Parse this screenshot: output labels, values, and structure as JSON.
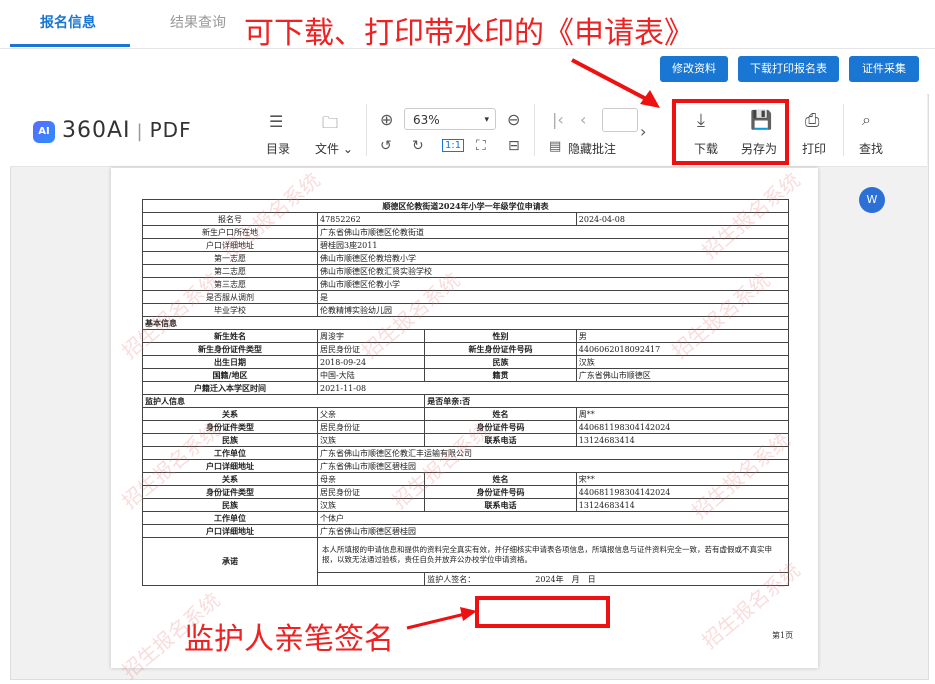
{
  "tabs": [
    {
      "label": "报名信息"
    },
    {
      "label": "结果查询"
    }
  ],
  "annotations": {
    "top": "可下载、打印带水印的《申请表》",
    "bottom": "监护人亲笔签名"
  },
  "buttons": {
    "edit": "修改资料",
    "download_print": "下载打印报名表",
    "id_collect": "证件采集"
  },
  "viewer": {
    "brand": "360AI",
    "brand_pdf": "PDF",
    "ai_badge": "AI",
    "toolbar": {
      "toc": "目录",
      "file": "文件",
      "zoom": "63%",
      "hide_notes": "隐藏批注",
      "download": "下载",
      "save_as": "另存为",
      "print": "打印",
      "find": "查找",
      "fit": "1:1"
    },
    "word_badge": "W"
  },
  "form": {
    "title": "顺德区伦教街道2024年小学一年级学位申请表",
    "top_rows": [
      {
        "label": "报名号",
        "value": "47852262",
        "extra": "2024-04-08"
      },
      {
        "label": "新生户口所在地",
        "value": "广东省佛山市顺德区伦教街道",
        "extra": ""
      },
      {
        "label": "户口详细地址",
        "value": "碧桂园3座2011",
        "extra": ""
      },
      {
        "label": "第一志愿",
        "value": "佛山市顺德区伦教培教小学",
        "extra": ""
      },
      {
        "label": "第二志愿",
        "value": "佛山市顺德区伦教汇贤实验学校",
        "extra": ""
      },
      {
        "label": "第三志愿",
        "value": "佛山市顺德区伦教小学",
        "extra": ""
      },
      {
        "label": "是否服从调剂",
        "value": "是",
        "extra": ""
      },
      {
        "label": "毕业学校",
        "value": "伦教精博实验幼儿园",
        "extra": ""
      }
    ],
    "basic_section": "基本信息",
    "basic_rows": [
      {
        "l1": "新生姓名",
        "v1": "周浚宇",
        "l2": "性别",
        "v2": "男"
      },
      {
        "l1": "新生身份证件类型",
        "v1": "居民身份证",
        "l2": "新生身份证件号码",
        "v2": "4406062018092417"
      },
      {
        "l1": "出生日期",
        "v1": "2018-09-24",
        "l2": "民族",
        "v2": "汉族"
      },
      {
        "l1": "国籍/地区",
        "v1": "中国-大陆",
        "l2": "籍贯",
        "v2": "广东省佛山市顺德区"
      }
    ],
    "move_in": {
      "label": "户籍迁入本学区时间",
      "value": "2021-11-08"
    },
    "guardian_section": "监护人信息",
    "single_parent": "是否单亲:否",
    "guardian1": {
      "rows": [
        {
          "l1": "关系",
          "v1": "父亲",
          "l2": "姓名",
          "v2": "周**"
        },
        {
          "l1": "身份证件类型",
          "v1": "居民身份证",
          "l2": "身份证件号码",
          "v2": "440681198304142024"
        },
        {
          "l1": "民族",
          "v1": "汉族",
          "l2": "联系电话",
          "v2": "13124683414"
        }
      ],
      "work": {
        "label": "工作单位",
        "value": "广东省佛山市顺德区伦教汇丰运输有限公司"
      },
      "addr": {
        "label": "户口详细地址",
        "value": "广东省佛山市顺德区碧桂园"
      }
    },
    "guardian2": {
      "rows": [
        {
          "l1": "关系",
          "v1": "母亲",
          "l2": "姓名",
          "v2": "宋**"
        },
        {
          "l1": "身份证件类型",
          "v1": "居民身份证",
          "l2": "身份证件号码",
          "v2": "440681198304142024"
        },
        {
          "l1": "民族",
          "v1": "汉族",
          "l2": "联系电话",
          "v2": "13124683414"
        }
      ],
      "work": {
        "label": "工作单位",
        "value": "个体户"
      },
      "addr": {
        "label": "户口详细地址",
        "value": "广东省佛山市顺德区碧桂园"
      }
    },
    "promise": {
      "label": "承诺",
      "text1": "本人所填报的申请信息和提供的资料完全真实有效，并仔细核实申请表各项信息，所填报信息与证件资料完全一致",
      "text2": "，若有虚假或不真实申报，以致无法通过验核，责任自负并放弃公办校学位申请资格。",
      "sign": "监护人签名：",
      "date": "2024年　月　日"
    },
    "page_no": "第1页",
    "watermark": "招生报名系统"
  }
}
